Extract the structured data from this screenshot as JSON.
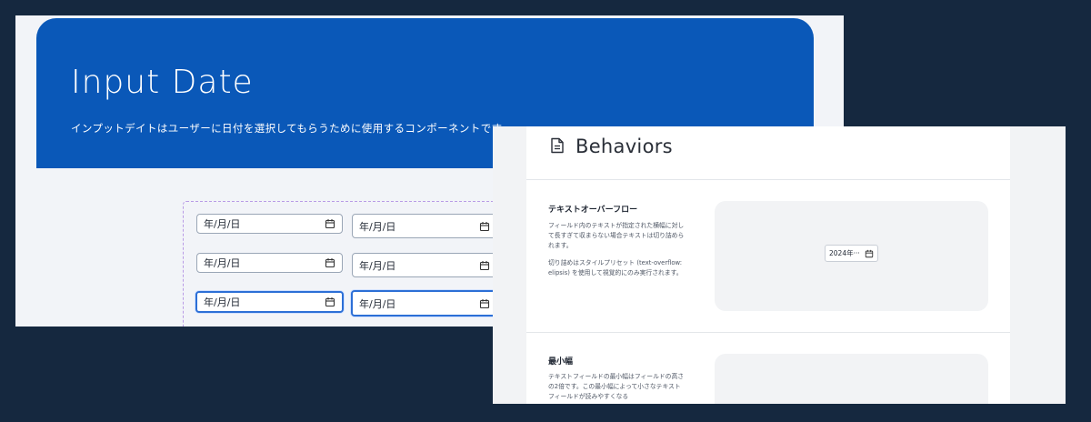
{
  "left": {
    "title": "Input Date",
    "description": "インプットデイトはユーザーに日付を選択してもらうために使用するコンポーネントです。",
    "placeholder": "年/月/日"
  },
  "right": {
    "title": "Behaviors",
    "sections": [
      {
        "title": "テキストオーバーフロー",
        "text1": "フィールド内のテキストが指定された横幅に対して長すぎて収まらない場合テキストは切り詰められます。",
        "text2": "切り詰めはスタイルプリセット (text-overflow: elipsis) を使用して視覚的にのみ実行されます。",
        "demo_value": "2024年···"
      },
      {
        "title": "最小幅",
        "text1": "テキストフィールドの最小幅はフィールドの高さの2倍です。この最小幅によって小さなテキストフィールドが読みやすくなる"
      }
    ]
  },
  "icons": {
    "calendar": "calendar-icon",
    "document": "document-icon"
  },
  "colors": {
    "hero": "#0a58b8",
    "background": "#15283f",
    "focus": "#2c6fd6",
    "preview_border": "#b99be6"
  }
}
